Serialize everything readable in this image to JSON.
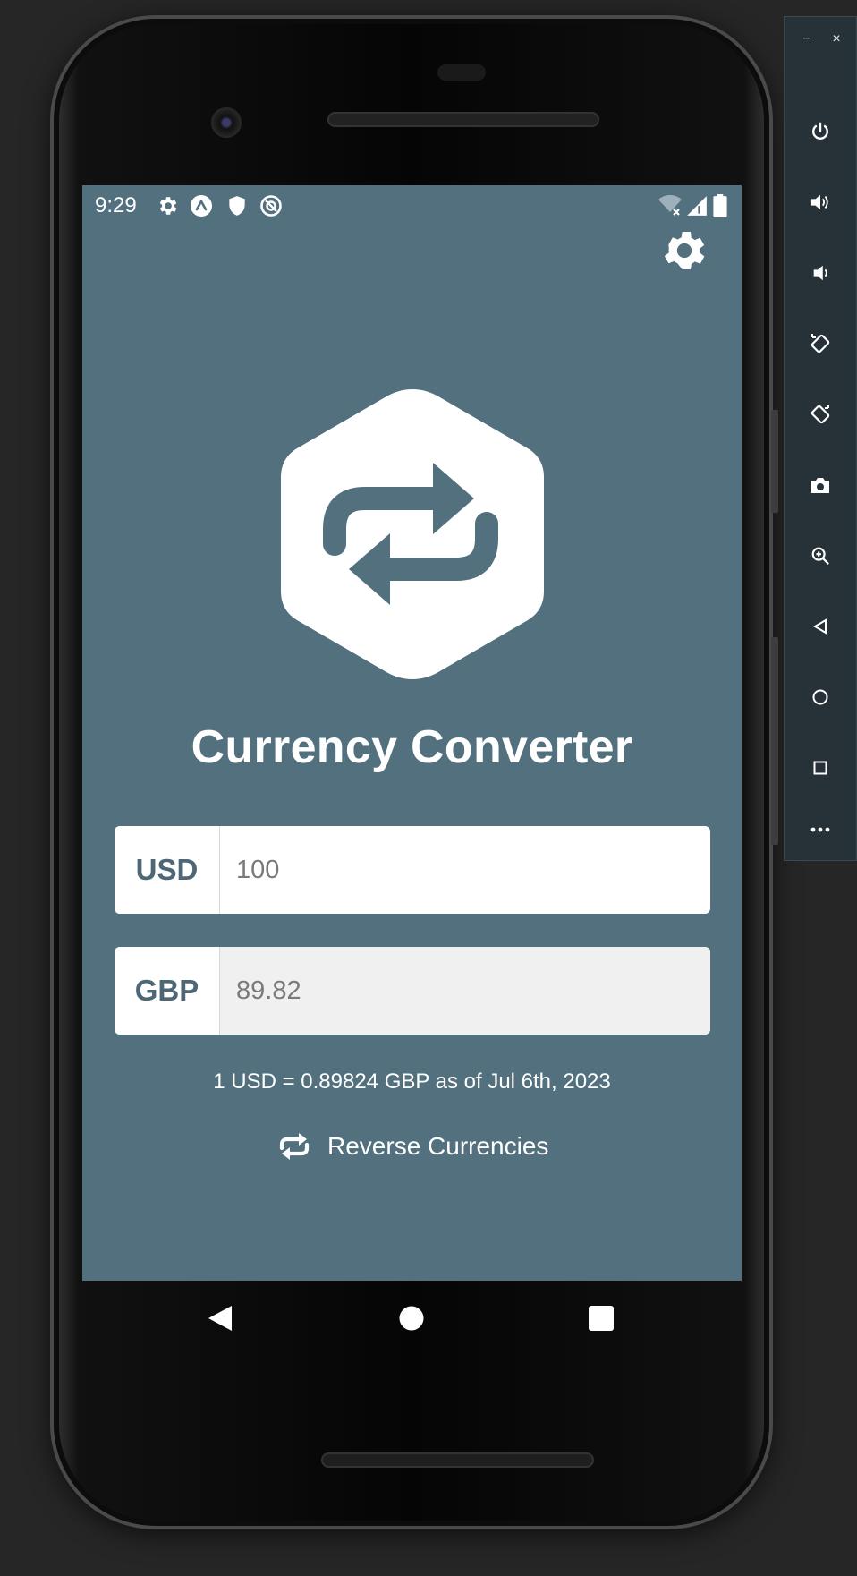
{
  "status_bar": {
    "time": "9:29"
  },
  "app": {
    "title": "Currency Converter",
    "base_currency": "USD",
    "base_amount": "100",
    "quote_currency": "GBP",
    "quote_amount": "89.82",
    "rate_text": "1 USD = 0.89824 GBP as of Jul 6th, 2023",
    "reverse_label": "Reverse Currencies"
  },
  "colors": {
    "background": "#52707d",
    "card": "#ffffff",
    "readonly_field": "#f0f0f0",
    "currency_text": "#4d6776"
  },
  "emulator_toolbar": {
    "minimize": "−",
    "close": "×"
  }
}
